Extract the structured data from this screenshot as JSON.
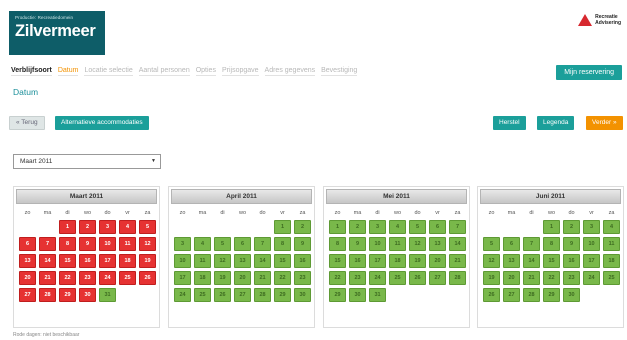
{
  "logo": {
    "subtitle": "Productie: Recreatiedomein",
    "name": "Zilvermeer"
  },
  "brand": {
    "line1": "Recreatie",
    "line2": "Advisering"
  },
  "steps": [
    {
      "label": "Verblijfsoort",
      "state": "done"
    },
    {
      "label": "Datum",
      "state": "active"
    },
    {
      "label": "Locatie selectie",
      "state": "todo"
    },
    {
      "label": "Aantal personen",
      "state": "todo"
    },
    {
      "label": "Opties",
      "state": "todo"
    },
    {
      "label": "Prijsopgave",
      "state": "todo"
    },
    {
      "label": "Adres gegevens",
      "state": "todo"
    },
    {
      "label": "Bevestiging",
      "state": "todo"
    }
  ],
  "mijn_button": "Mijn reservering",
  "page_title": "Datum",
  "toolbar": {
    "terug": "« Terug",
    "alternatieve": "Alternatieve accommodaties",
    "herstel": "Herstel",
    "legenda": "Legenda",
    "verder": "Verder »"
  },
  "month_select": {
    "value": "Maart 2011",
    "arrow": "▼"
  },
  "weekdays": [
    "zo",
    "ma",
    "di",
    "wo",
    "do",
    "vr",
    "za"
  ],
  "months": [
    {
      "name": "Maart 2011",
      "offset": 2,
      "days": 31,
      "red_until": 30
    },
    {
      "name": "April 2011",
      "offset": 5,
      "days": 30,
      "red_until": 0
    },
    {
      "name": "Mei 2011",
      "offset": 0,
      "days": 31,
      "red_until": 0
    },
    {
      "name": "Juni 2011",
      "offset": 3,
      "days": 30,
      "red_until": 0
    }
  ],
  "colors": {
    "teal": "#1b9f9a",
    "orange": "#f39200",
    "occupied": "#e63232",
    "available": "#79b84a"
  },
  "footnote": "Rode dagen: niet beschikbaar"
}
